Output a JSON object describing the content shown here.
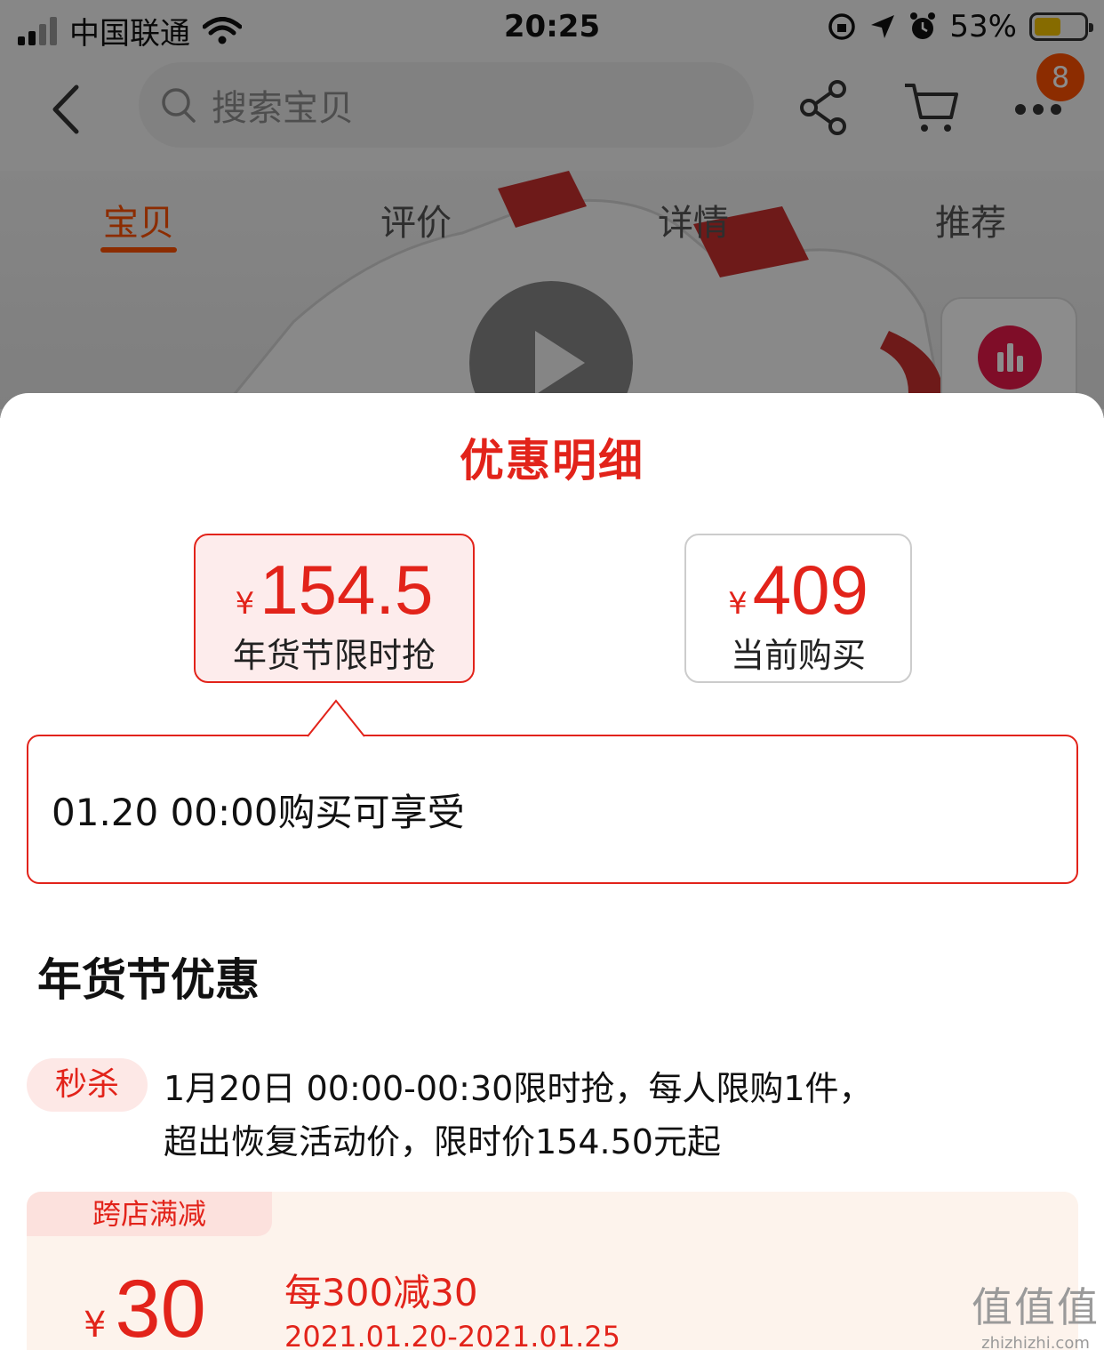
{
  "status_bar": {
    "carrier": "中国联通",
    "time": "20:25",
    "battery_percent": "53%",
    "battery_level": 0.53,
    "icons": [
      "wifi-icon",
      "orientation-lock-icon",
      "location-icon",
      "alarm-icon"
    ]
  },
  "nav": {
    "search_placeholder": "搜索宝贝",
    "cart_badge": "8",
    "icons": [
      "back-icon",
      "search-icon",
      "share-icon",
      "cart-icon",
      "more-icon"
    ]
  },
  "tabs": [
    {
      "label": "宝贝",
      "active": true
    },
    {
      "label": "评价",
      "active": false
    },
    {
      "label": "详情",
      "active": false
    },
    {
      "label": "推荐",
      "active": false
    }
  ],
  "colors": {
    "accent": "#e2231a",
    "brand_orange": "#ff5000"
  },
  "sheet": {
    "title": "优惠明细",
    "price_cards": [
      {
        "currency": "¥",
        "price": "154.5",
        "label": "年货节限时抢",
        "selected": true
      },
      {
        "currency": "¥",
        "price": "409",
        "label": "当前购买",
        "selected": false
      }
    ],
    "info_text": "01.20 00:00购买可享受",
    "section_title": "年货节优惠",
    "promo": {
      "tag": "秒杀",
      "line1": "1月20日 00:00-00:30限时抢，每人限购1件，",
      "line2": "超出恢复活动价，限时价154.50元起"
    },
    "coupon": {
      "tag": "跨店满减",
      "currency": "¥",
      "amount": "30",
      "rule": "每300减30",
      "date": "2021.01.20-2021.01.25"
    }
  },
  "watermark": {
    "glyphs": "值值值",
    "url": "zhizhizhi.com"
  }
}
